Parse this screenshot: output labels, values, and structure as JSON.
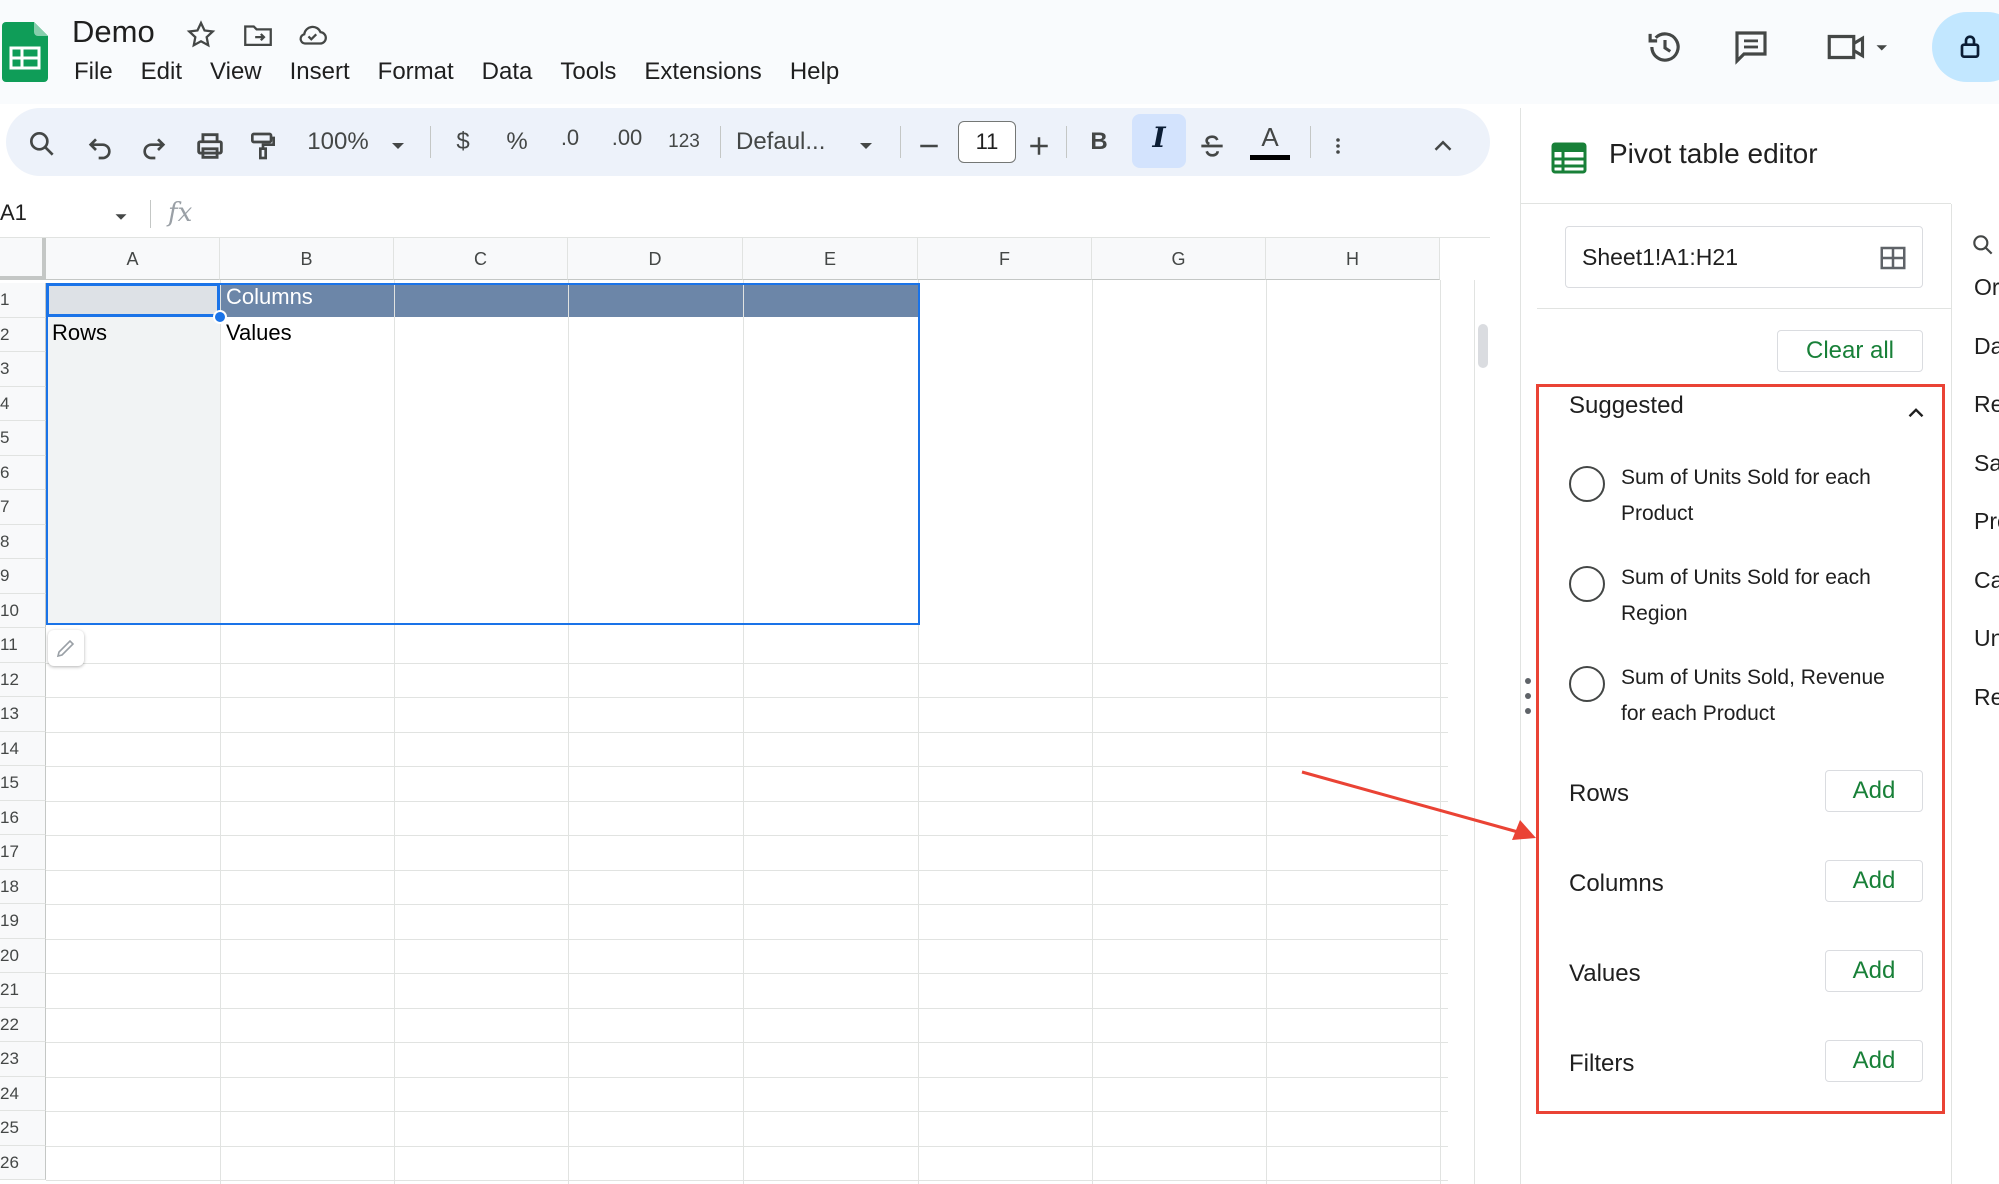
{
  "app": {
    "doc_title": "Demo",
    "menus": [
      "File",
      "Edit",
      "View",
      "Insert",
      "Format",
      "Data",
      "Tools",
      "Extensions",
      "Help"
    ],
    "accent_color": "#188038",
    "selection_color": "#1a73e8",
    "annotation_color": "#ea4335"
  },
  "toolbar": {
    "zoom": "100%",
    "currency": "$",
    "percent": "%",
    "decrease_decimal": ".0",
    "increase_decimal": ".00",
    "number_format": "123",
    "font": "Defaul...",
    "font_size": "11",
    "bold": "B",
    "italic": "I",
    "text_color_glyph": "A"
  },
  "formula_bar": {
    "name_box": "A1",
    "fx_label": "fx"
  },
  "grid": {
    "columns": [
      "A",
      "B",
      "C",
      "D",
      "E",
      "F",
      "G",
      "H"
    ],
    "rows": [
      "1",
      "2",
      "3",
      "4",
      "5",
      "6",
      "7",
      "8",
      "9",
      "10",
      "11",
      "12",
      "13",
      "14",
      "15",
      "16",
      "17",
      "18",
      "19",
      "20",
      "21",
      "22",
      "23",
      "24",
      "25",
      "26"
    ],
    "cells": {
      "B1": "Columns",
      "A2": "Rows",
      "B2": "Values"
    },
    "pivot_header_color": "#6c86a8"
  },
  "pivot_editor": {
    "title": "Pivot table editor",
    "range": "Sheet1!A1:H21",
    "clear_all": "Clear all",
    "suggested_label": "Suggested",
    "suggestions": [
      {
        "line1": "Sum of Units Sold for each",
        "line2": "Product"
      },
      {
        "line1": "Sum of Units Sold for each",
        "line2": "Region"
      },
      {
        "line1": "Sum of Units Sold, Revenue",
        "line2": "for each Product"
      }
    ],
    "sections": [
      {
        "label": "Rows",
        "button": "Add"
      },
      {
        "label": "Columns",
        "button": "Add"
      },
      {
        "label": "Values",
        "button": "Add"
      },
      {
        "label": "Filters",
        "button": "Add"
      }
    ],
    "field_list_partial": [
      "Ord",
      "Da",
      "Re",
      "Sa",
      "Pro",
      "Ca",
      "Un",
      "Re"
    ]
  }
}
